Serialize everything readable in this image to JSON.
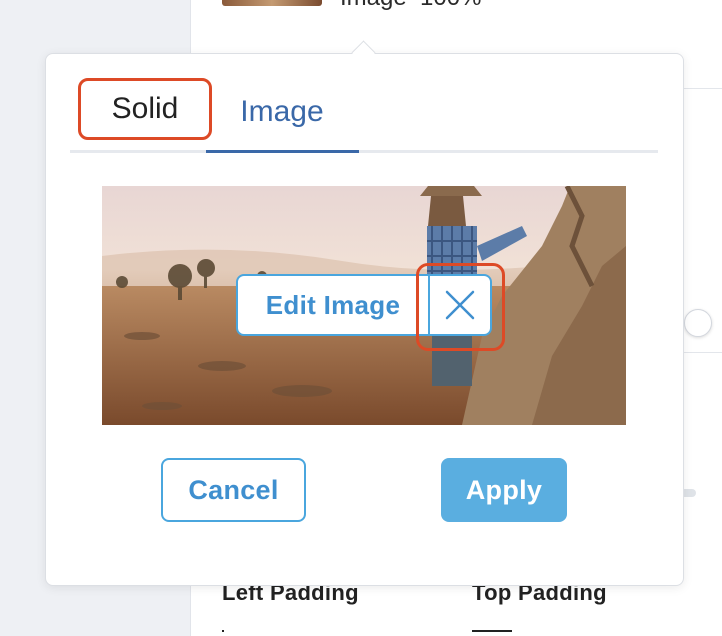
{
  "background": {
    "thumbnail_label": "Image",
    "thumbnail_value": "100%",
    "fields": {
      "left_padding_label": "Left Padding",
      "top_padding_label": "Top Padding"
    }
  },
  "popover": {
    "tabs": [
      {
        "label": "Solid",
        "highlighted": true
      },
      {
        "label": "Image",
        "active": true
      }
    ],
    "image_preview": {
      "overlay": {
        "edit_label": "Edit Image",
        "remove_icon": "close-icon"
      }
    },
    "buttons": {
      "cancel_label": "Cancel",
      "apply_label": "Apply"
    }
  },
  "colors": {
    "accent": "#4aa6de",
    "apply_fill": "#5aaee0",
    "tab_active": "#3a68a8",
    "highlight": "#dd4a26"
  }
}
